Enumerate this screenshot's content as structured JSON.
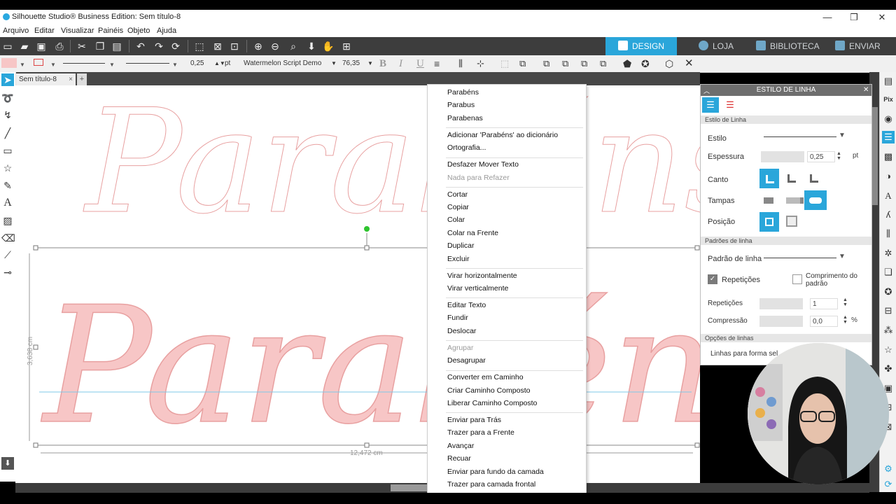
{
  "window": {
    "title": "Silhouette Studio® Business Edition: Sem título-8",
    "minimize": "—",
    "maximize": "❐",
    "close": "✕"
  },
  "menu": [
    "Arquivo",
    "Editar",
    "Visualizar",
    "Painéis",
    "Objeto",
    "Ajuda"
  ],
  "nav_tabs": [
    {
      "label": "DESIGN",
      "icon": "grid-icon",
      "active": true
    },
    {
      "label": "LOJA",
      "icon": "store-icon",
      "active": false
    },
    {
      "label": "BIBLIOTECA",
      "icon": "download-library-icon",
      "active": false
    },
    {
      "label": "ENVIAR",
      "icon": "cutter-icon",
      "active": false
    }
  ],
  "format_bar": {
    "line_width": "0,25",
    "unit": "pt",
    "font": "Watermelon Script Demo",
    "font_size": "76,35",
    "bold": "B",
    "italic": "I",
    "underline": "U"
  },
  "document_tab": {
    "label": "Sem título-8",
    "close": "×",
    "add": "+"
  },
  "canvas": {
    "word": "Parabéns",
    "fill_color": "#f7c6c6",
    "stroke_color": "#e8a0a0",
    "width_label": "12,472 cm",
    "height_label": "3,638 cm"
  },
  "context_menu": {
    "groups": [
      [
        {
          "label": "Parabéns"
        },
        {
          "label": "Parabus"
        },
        {
          "label": "Parabenas"
        }
      ],
      [
        {
          "label": "Adicionar 'Parabéns' ao dicionário"
        },
        {
          "label": "Ortografia..."
        }
      ],
      [
        {
          "label": "Desfazer Mover Texto"
        },
        {
          "label": "Nada para Refazer",
          "disabled": true
        }
      ],
      [
        {
          "label": "Cortar"
        },
        {
          "label": "Copiar"
        },
        {
          "label": "Colar"
        },
        {
          "label": "Colar na Frente"
        },
        {
          "label": "Duplicar"
        },
        {
          "label": "Excluir"
        }
      ],
      [
        {
          "label": "Virar horizontalmente"
        },
        {
          "label": "Virar  verticalmente"
        }
      ],
      [
        {
          "label": "Editar Texto"
        },
        {
          "label": "Fundir"
        },
        {
          "label": "Deslocar"
        }
      ],
      [
        {
          "label": "Agrupar",
          "disabled": true
        },
        {
          "label": "Desagrupar"
        }
      ],
      [
        {
          "label": "Converter em Caminho"
        },
        {
          "label": "Criar Caminho Composto"
        },
        {
          "label": "Liberar Caminho Composto"
        }
      ],
      [
        {
          "label": "Enviar para Trás"
        },
        {
          "label": "Trazer para a Frente"
        },
        {
          "label": "Avançar"
        },
        {
          "label": "Recuar"
        },
        {
          "label": "Enviar para fundo da camada"
        },
        {
          "label": "Trazer para camada frontal"
        }
      ]
    ]
  },
  "panel": {
    "title": "ESTILO DE LINHA",
    "section_style": "Estilo de Linha",
    "estilo": "Estilo",
    "espessura": "Espessura",
    "espessura_value": "0,25",
    "espessura_unit": "pt",
    "canto": "Canto",
    "tampas": "Tampas",
    "posicao": "Posição",
    "section_patterns": "Padrões de linha",
    "padrao": "Padrão de linha",
    "repeticoes_check": "Repetições",
    "comprimento": "Comprimento do padrão",
    "repeticoes": "Repetições",
    "repeticoes_value": "1",
    "compressao": "Compressão",
    "compressao_value": "0,0",
    "compressao_unit": "%",
    "section_options": "Opções de linhas",
    "linhas": "Linhas para forma sel"
  }
}
